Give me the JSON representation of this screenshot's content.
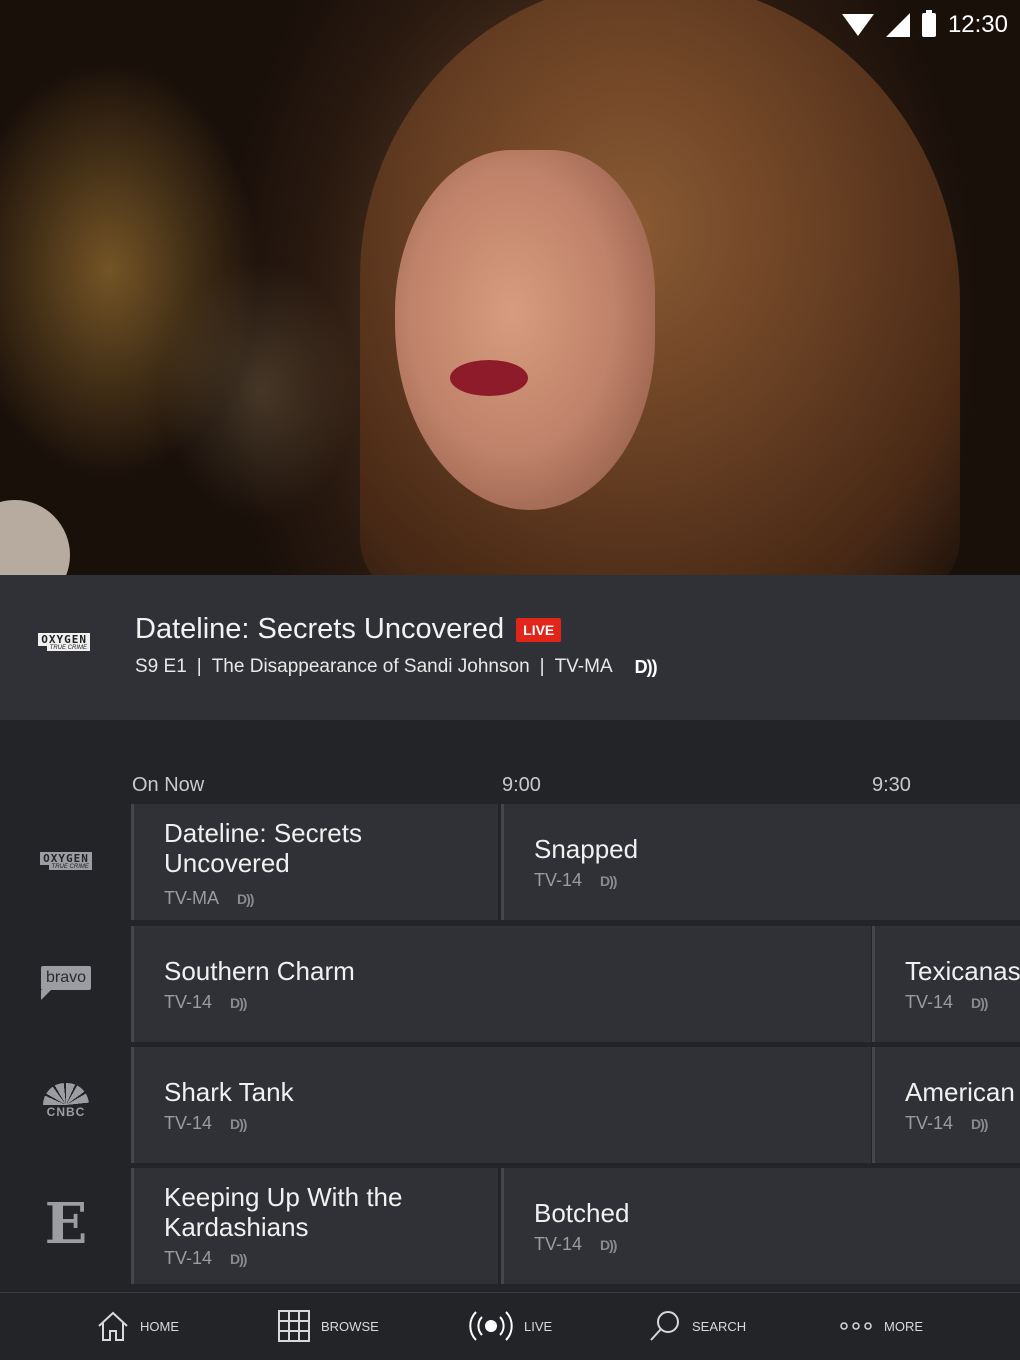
{
  "status_bar": {
    "time": "12:30"
  },
  "now_playing": {
    "channel_logo": "oxygen-true-crime-logo",
    "logo_text": "OXYGEN",
    "logo_subtext": "TRUE CRIME",
    "title": "Dateline: Secrets Uncovered",
    "live_badge": "LIVE",
    "episode": "S9 E1",
    "separator": "|",
    "episode_title": "The Disappearance of Sandi Johnson",
    "rating": "TV-MA",
    "audio_icon": "descriptive-video-icon"
  },
  "guide": {
    "time_labels": [
      "On Now",
      "9:00",
      "9:30"
    ],
    "rows": [
      {
        "channel": "oxygen-true-crime-logo",
        "logo_text": "OXYGEN",
        "logo_subtext": "TRUE CRIME",
        "programs": [
          {
            "title_lines": [
              "Dateline: Secrets",
              "Uncovered"
            ],
            "rating": "TV-MA"
          },
          {
            "title_lines": [
              "Snapped"
            ],
            "rating": "TV-14"
          }
        ]
      },
      {
        "channel": "bravo-logo",
        "logo_text": "bravo",
        "programs": [
          {
            "title_lines": [
              "Southern Charm"
            ],
            "rating": "TV-14"
          },
          {
            "title_lines": [
              "Texicanas"
            ],
            "rating": "TV-14"
          }
        ]
      },
      {
        "channel": "cnbc-logo",
        "logo_text": "CNBC",
        "programs": [
          {
            "title_lines": [
              "Shark Tank"
            ],
            "rating": "TV-14"
          },
          {
            "title_lines": [
              "American"
            ],
            "rating": "TV-14"
          }
        ]
      },
      {
        "channel": "e-logo",
        "logo_text": "E",
        "programs": [
          {
            "title_lines": [
              "Keeping Up With the",
              "Kardashians"
            ],
            "rating": "TV-14"
          },
          {
            "title_lines": [
              "Botched"
            ],
            "rating": "TV-14"
          }
        ]
      }
    ]
  },
  "dv_icon_text": "D))",
  "bottom_nav": [
    {
      "label": "HOME",
      "icon": "home-icon"
    },
    {
      "label": "BROWSE",
      "icon": "grid-icon"
    },
    {
      "label": "LIVE",
      "icon": "broadcast-icon"
    },
    {
      "label": "SEARCH",
      "icon": "search-icon"
    },
    {
      "label": "MORE",
      "icon": "more-dots-icon"
    }
  ],
  "colors": {
    "live_red": "#e1251b",
    "panel": "#303136",
    "background": "#232428"
  }
}
